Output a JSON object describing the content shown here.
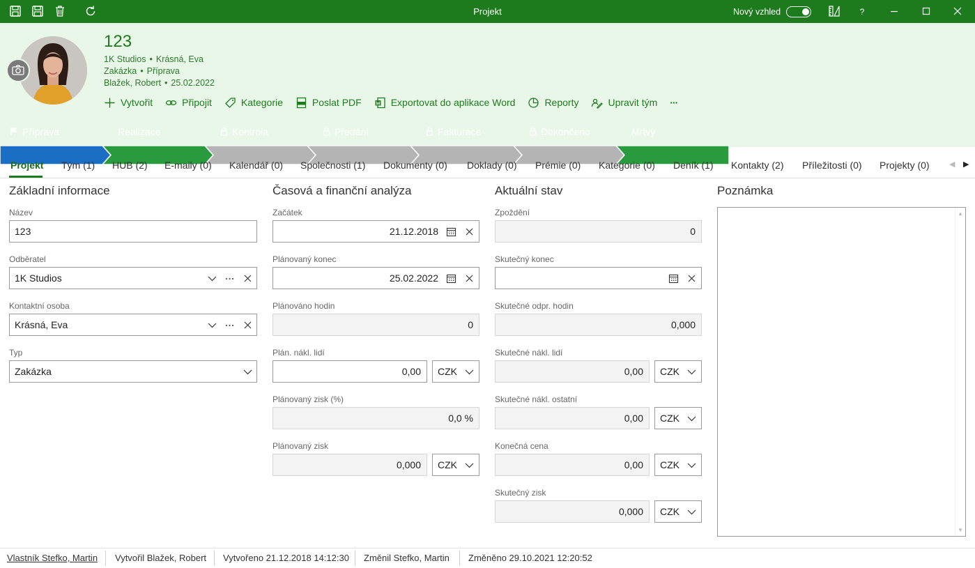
{
  "window": {
    "title": "Projekt",
    "new_look_label": "Nový vzhled",
    "help_label": "?"
  },
  "header": {
    "title": "123",
    "line1": {
      "a": "1K Studios",
      "b": "Krásná, Eva"
    },
    "line2": {
      "a": "Zakázka",
      "b": "Příprava"
    },
    "line3": {
      "a": "Blažek, Robert",
      "b": "25.02.2022"
    },
    "actions": {
      "create": "Vytvořit",
      "connect": "Připojit",
      "category": "Kategorie",
      "send_pdf": "Poslat PDF",
      "export_word": "Exportovat do aplikace Word",
      "reports": "Reporty",
      "edit_team": "Upravit tým",
      "more": "···"
    }
  },
  "stages": [
    {
      "label": "Příprava",
      "state": "current"
    },
    {
      "label": "Realizace",
      "state": "open"
    },
    {
      "label": "Kontrola",
      "state": "locked"
    },
    {
      "label": "Předání",
      "state": "locked"
    },
    {
      "label": "Fakturace",
      "state": "locked"
    },
    {
      "label": "Dokončeno",
      "state": "locked"
    },
    {
      "label": "Mrtvý",
      "state": "open"
    }
  ],
  "tabs": [
    "Projekt",
    "Tým (1)",
    "HUB (2)",
    "E-maily (0)",
    "Kalendář (0)",
    "Společnosti (1)",
    "Dokumenty (0)",
    "Doklady (0)",
    "Prémie (0)",
    "Kategorie (0)",
    "Deník (1)",
    "Kontakty (2)",
    "Příležitosti (0)",
    "Projekty (0)"
  ],
  "basic": {
    "title": "Základní informace",
    "name_label": "Název",
    "name_value": "123",
    "customer_label": "Odběratel",
    "customer_value": "1K Studios",
    "contact_label": "Kontaktní osoba",
    "contact_value": "Krásná, Eva",
    "type_label": "Typ",
    "type_value": "Zakázka"
  },
  "analysis": {
    "title": "Časová a finanční analýza",
    "start_label": "Začátek",
    "start_value": "21.12.2018",
    "planned_end_label": "Plánovaný konec",
    "planned_end_value": "25.02.2022",
    "planned_hours_label": "Plánováno hodin",
    "planned_hours_value": "0",
    "planned_cost_label": "Plán. nákl. lidí",
    "planned_cost_value": "0,00",
    "planned_cost_currency": "CZK",
    "planned_profit_pct_label": "Plánovaný zisk (%)",
    "planned_profit_pct_value": "0,0 %",
    "planned_profit_label": "Plánovaný zisk",
    "planned_profit_value": "0,000",
    "planned_profit_currency": "CZK"
  },
  "status": {
    "title": "Aktuální stav",
    "delay_label": "Zpoždění",
    "delay_value": "0",
    "actual_end_label": "Skutečný konec",
    "actual_end_value": "",
    "actual_hours_label": "Skutečné odpr. hodin",
    "actual_hours_value": "0,000",
    "actual_cost_people_label": "Skutečné nákl. lidí",
    "actual_cost_people_value": "0,00",
    "actual_cost_people_currency": "CZK",
    "actual_cost_other_label": "Skutečné nákl. ostatní",
    "actual_cost_other_value": "0,00",
    "actual_cost_other_currency": "CZK",
    "final_price_label": "Konečná cena",
    "final_price_value": "0,00",
    "final_price_currency": "CZK",
    "actual_profit_label": "Skutečný zisk",
    "actual_profit_value": "0,000",
    "actual_profit_currency": "CZK"
  },
  "note": {
    "title": "Poznámka"
  },
  "footer": {
    "owner": "Vlastník Stefko, Martin",
    "created_by": "Vytvořil Blažek, Robert",
    "created_at": "Vytvořeno 21.12.2018 14:12:30",
    "changed_by": "Změnil Stefko, Martin",
    "changed_at": "Změněno 29.10.2021 12:20:52"
  },
  "colors": {
    "brand_green": "#1d7a1d",
    "stage_current": "#1a6fc4",
    "stage_open": "#2a9a3e",
    "stage_locked": "#b4b4b4"
  }
}
